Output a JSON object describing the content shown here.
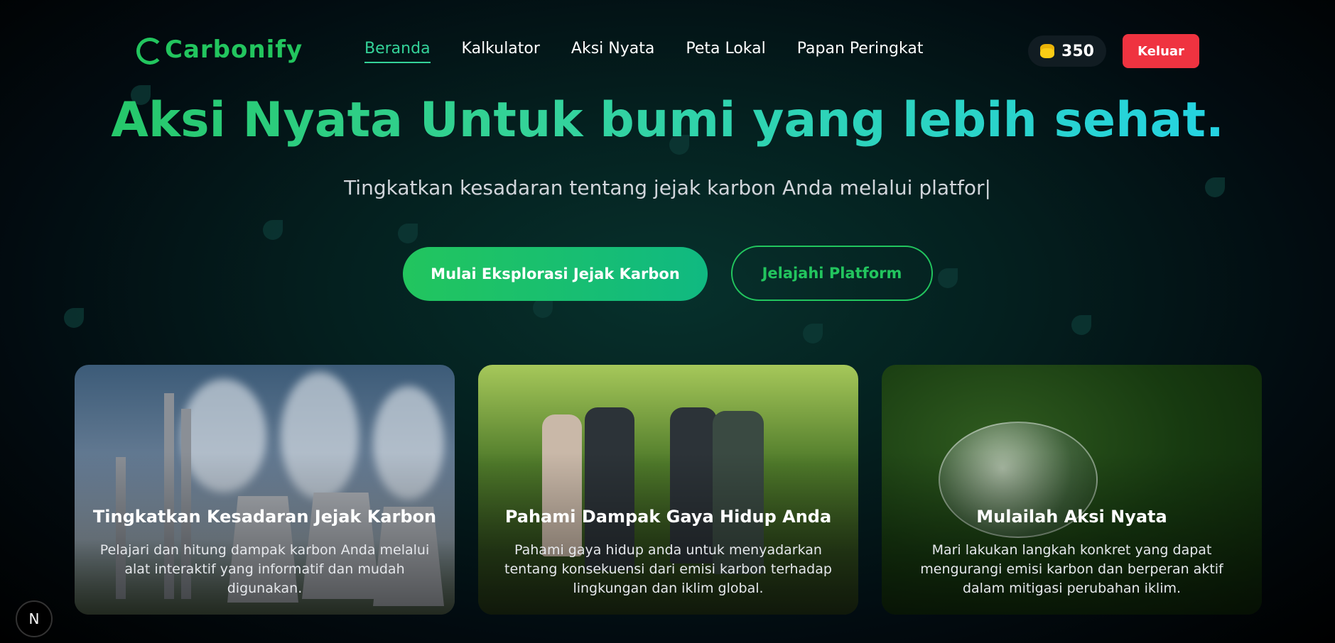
{
  "nav": {
    "logo": "Carbonify",
    "items": [
      "Beranda",
      "Kalkulator",
      "Aksi Nyata",
      "Peta Lokal",
      "Papan Peringkat"
    ],
    "active_index": 0,
    "coins": "350",
    "logout_label": "Keluar"
  },
  "hero": {
    "title": "Aksi Nyata Untuk bumi yang lebih sehat.",
    "subtitle": "Tingkatkan kesadaran tentang jejak karbon Anda melalui platfor|",
    "primary_button": "Mulai Eksplorasi Jejak Karbon",
    "secondary_button": "Jelajahi Platform"
  },
  "cards": [
    {
      "title": "Tingkatkan Kesadaran Jejak Karbon",
      "description": "Pelajari dan hitung dampak karbon Anda melalui alat interaktif yang informatif dan mudah digunakan."
    },
    {
      "title": "Pahami Dampak Gaya Hidup Anda",
      "description": "Pahami gaya hidup anda untuk menyadarkan tentang konsekuensi dari emisi karbon terhadap lingkungan dan iklim global."
    },
    {
      "title": "Mulailah Aksi Nyata",
      "description": "Mari lakukan langkah konkret yang dapat mengurangi emisi karbon dan berperan aktif dalam mitigasi perubahan iklim."
    }
  ],
  "badge": "N",
  "colors": {
    "accent": "#22c55e",
    "cyan": "#22d3ee",
    "danger": "#ef3340"
  },
  "icons": {
    "coins": "coin-stack-icon",
    "logo": "leaf-logo-icon"
  }
}
